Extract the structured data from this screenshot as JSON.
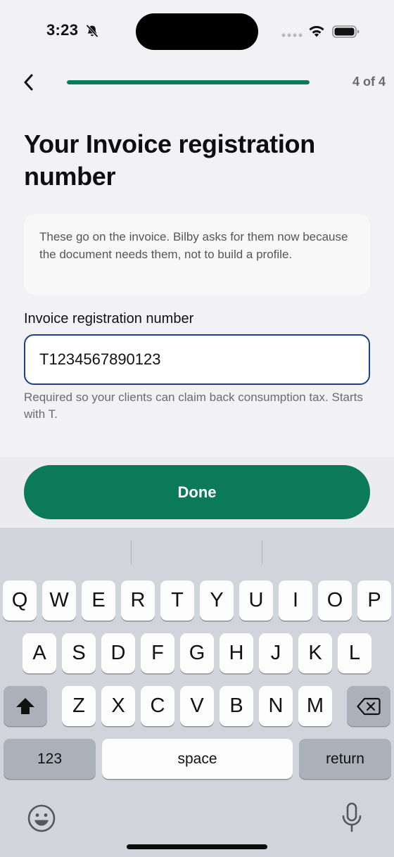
{
  "status_bar": {
    "time": "3:23",
    "icons": [
      "bell-slash-icon",
      "signal-icon",
      "wifi-icon",
      "battery-icon"
    ]
  },
  "header": {
    "back_icon": "chevron-left-icon",
    "progress": 1.0,
    "step_label": "4 of 4"
  },
  "title": "Your Invoice registration number",
  "info_card": {
    "text": "These go on the invoice. Bilby asks for them now because the document needs them, not to build a profile."
  },
  "field": {
    "label": "Invoice registration number",
    "value": "T1234567890123",
    "helper": "Required so your clients can claim back consumption tax. Starts with T."
  },
  "done_label": "Done",
  "keyboard": {
    "row1": [
      "Q",
      "W",
      "E",
      "R",
      "T",
      "Y",
      "U",
      "I",
      "O",
      "P"
    ],
    "row2": [
      "A",
      "S",
      "D",
      "F",
      "G",
      "H",
      "J",
      "K",
      "L"
    ],
    "row3": [
      "Z",
      "X",
      "C",
      "V",
      "B",
      "N",
      "M"
    ],
    "shift_icon": "shift-icon",
    "delete_icon": "delete-icon",
    "numbers_label": "123",
    "space_label": "space",
    "return_label": "return",
    "emoji_icon": "emoji-icon",
    "mic_icon": "microphone-icon"
  },
  "colors": {
    "accent": "#0b7a57",
    "input_border": "#1f3e8c",
    "background": "#f2f2f4"
  }
}
